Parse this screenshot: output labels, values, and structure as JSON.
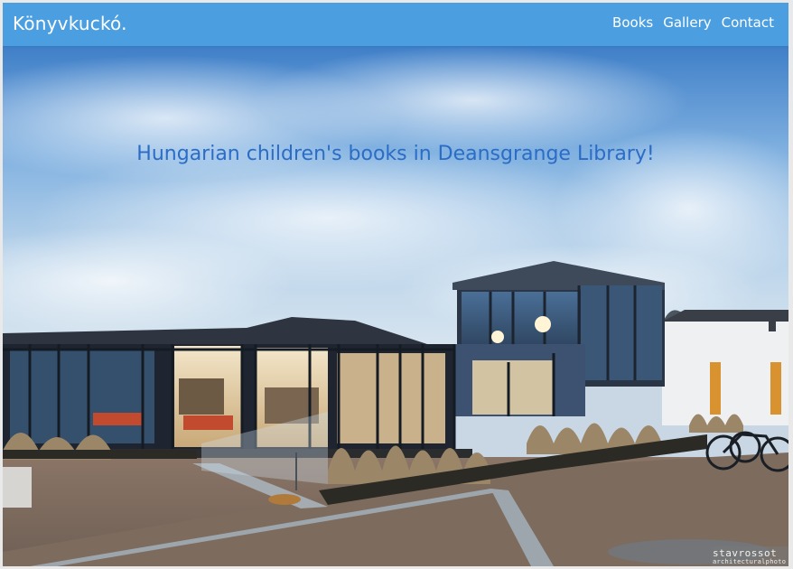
{
  "navbar": {
    "brand": "Könyvkuckó.",
    "links": [
      {
        "label": "Books"
      },
      {
        "label": "Gallery"
      },
      {
        "label": "Contact"
      }
    ]
  },
  "hero": {
    "headline": "Hungarian children's books in Deansgrange Library!",
    "watermark": {
      "main": "stavrossot",
      "sub": "architecturalphoto"
    }
  },
  "colors": {
    "navbar_bg": "#4b9fe1",
    "headline_text": "#2b6cc6",
    "nav_text": "#ffffff"
  }
}
